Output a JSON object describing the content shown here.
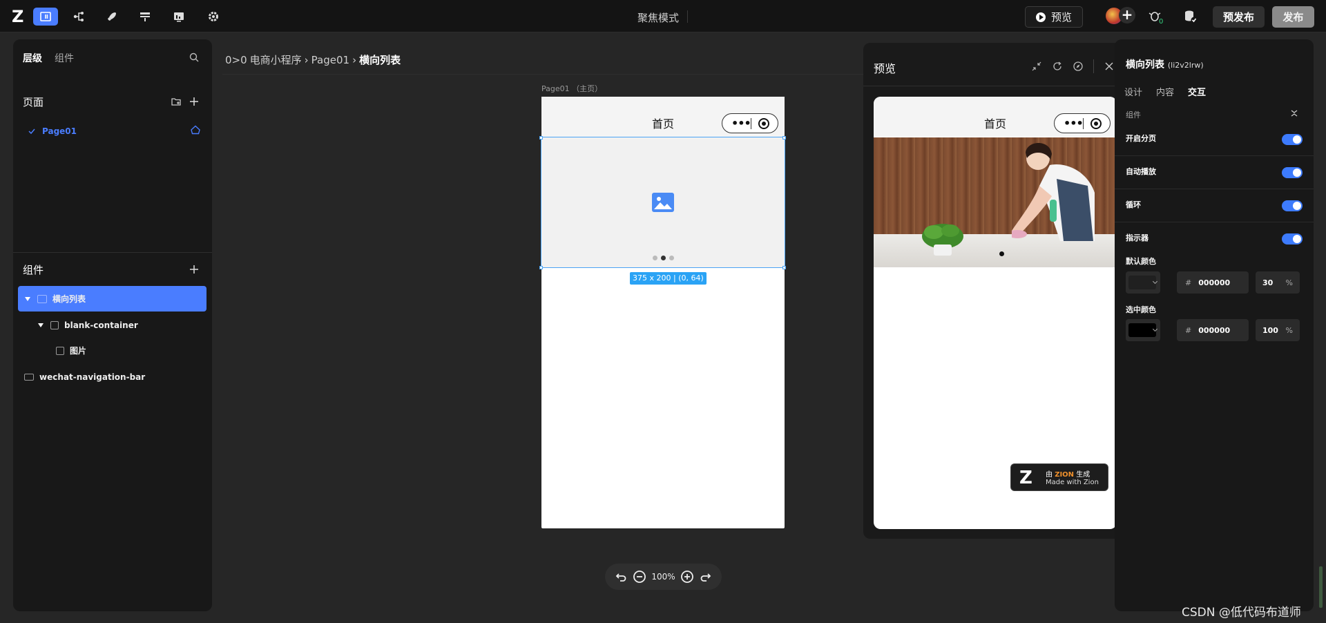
{
  "topbar": {
    "logo": "Z",
    "focus_mode": "聚焦模式",
    "preview_label": "预览",
    "prerelease_label": "预发布",
    "release_label": "发布",
    "bug_count": "0",
    "icons": [
      "page-editor-icon",
      "logic-flow-icon",
      "api-rocket-icon",
      "data-table-icon",
      "dashboard-icon",
      "settings-gear-icon"
    ]
  },
  "left_panel": {
    "tabs": [
      "层级",
      "组件"
    ],
    "pages_title": "页面",
    "page_item": "Page01",
    "components_title": "组件",
    "tree": [
      "横向列表",
      "blank-container",
      "图片",
      "wechat-navigation-bar"
    ]
  },
  "breadcrumb": {
    "icon_text": "0>0",
    "items": [
      "电商小程序",
      "Page01",
      "横向列表"
    ],
    "separator": "›"
  },
  "canvas": {
    "page_label": "Page01 （主页）",
    "nav_title": "首页",
    "capsule_dots": "•••",
    "size_tag": "375 x 200 | (0, 64)",
    "zoom": "100%"
  },
  "preview": {
    "title": "预览",
    "nav_title": "首页",
    "badge_line1_prefix": "由",
    "badge_brand": "ZION",
    "badge_line1_suffix": "生成",
    "badge_line2": "Made with Zion",
    "badge_logo": "Z"
  },
  "right_panel": {
    "title": "横向列表",
    "id": "(li2v2lrw)",
    "tabs": [
      "设计",
      "内容",
      "交互"
    ],
    "group": "组件",
    "toggles": [
      {
        "label": "开启分页",
        "on": true
      },
      {
        "label": "自动播放",
        "on": true
      },
      {
        "label": "循环",
        "on": true
      },
      {
        "label": "指示器",
        "on": true
      }
    ],
    "default_color": {
      "label": "默认颜色",
      "hex": "000000",
      "opacity": "30",
      "hash": "#",
      "pct": "%"
    },
    "selected_color": {
      "label": "选中颜色",
      "hex": "000000",
      "opacity": "100",
      "hash": "#",
      "pct": "%"
    }
  },
  "watermark": "CSDN @低代码布道师",
  "colors": {
    "accent": "#4a7dff",
    "selection": "#2aa3f5",
    "toggle": "#3d7bfd"
  }
}
